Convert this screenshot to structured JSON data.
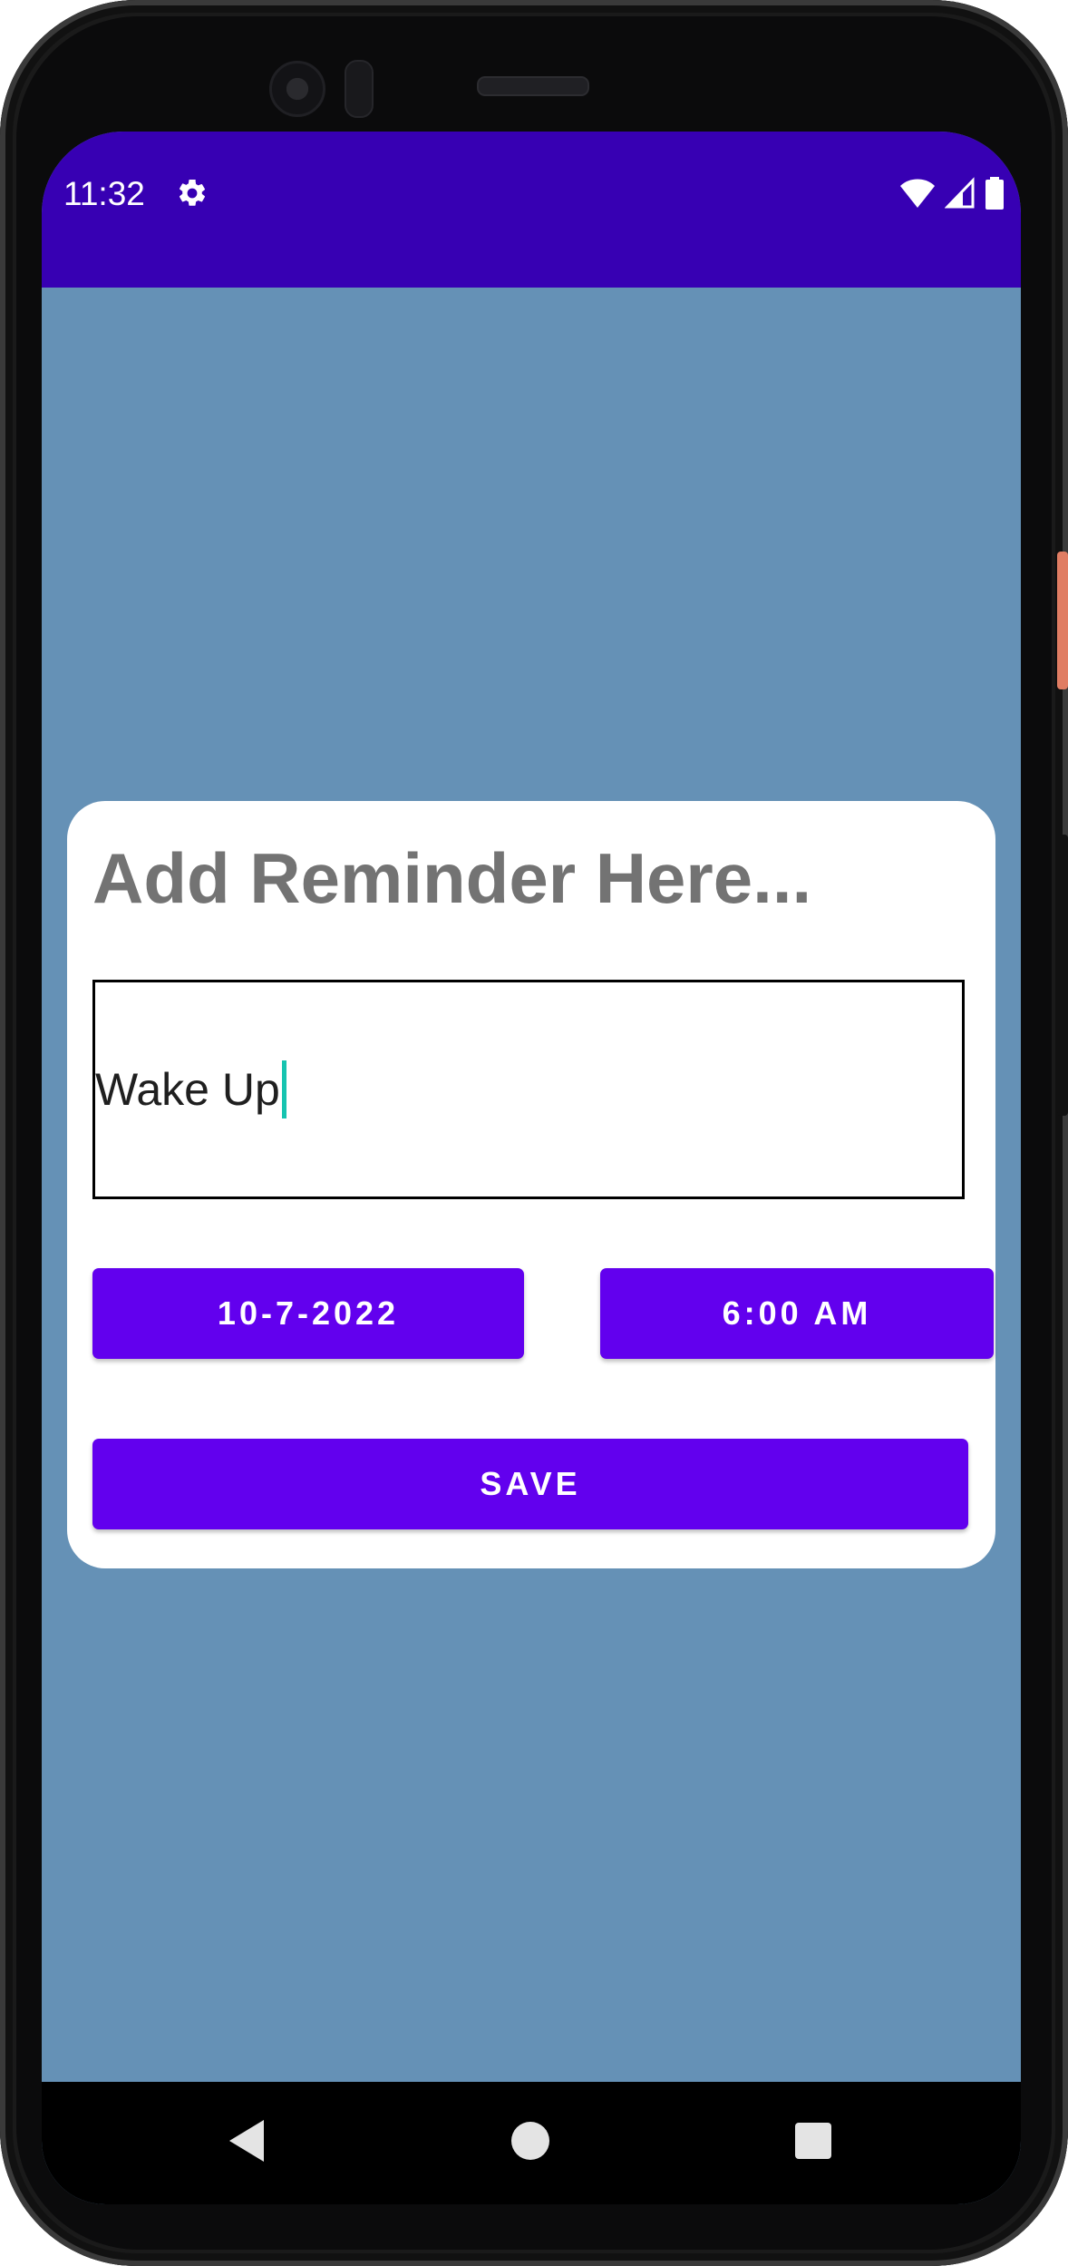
{
  "status_bar": {
    "time": "11:32",
    "background": "#3700b3",
    "icons": [
      "gear-icon",
      "wifi-icon",
      "cell-signal-icon",
      "battery-icon"
    ]
  },
  "app": {
    "background": "#6591b6"
  },
  "reminder_card": {
    "title": "Add Reminder Here...",
    "input_value": "Wake Up",
    "date_button_label": "10-7-2022",
    "time_button_label": "6:00 AM",
    "save_button_label": "SAVE",
    "button_color": "#6200ee",
    "caret_color": "#16c4b0"
  },
  "nav_bar": {
    "icons": [
      "back-icon",
      "home-icon",
      "recents-icon"
    ]
  }
}
